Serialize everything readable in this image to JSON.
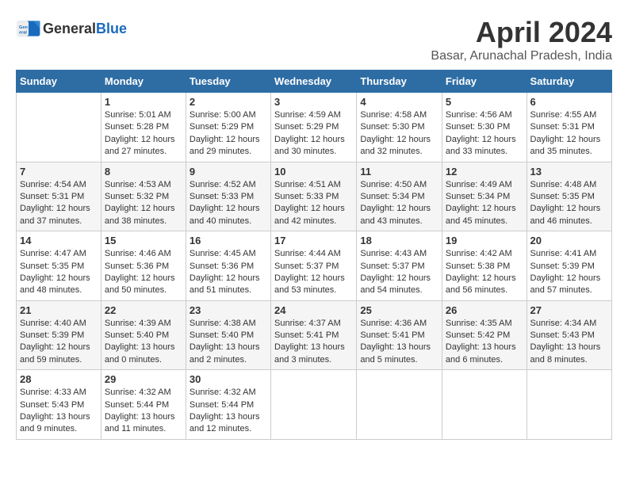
{
  "title": "April 2024",
  "subtitle": "Basar, Arunachal Pradesh, India",
  "logo": {
    "general": "General",
    "blue": "Blue"
  },
  "columns": [
    "Sunday",
    "Monday",
    "Tuesday",
    "Wednesday",
    "Thursday",
    "Friday",
    "Saturday"
  ],
  "weeks": [
    [
      {
        "day": "",
        "info": ""
      },
      {
        "day": "1",
        "info": "Sunrise: 5:01 AM\nSunset: 5:28 PM\nDaylight: 12 hours\nand 27 minutes."
      },
      {
        "day": "2",
        "info": "Sunrise: 5:00 AM\nSunset: 5:29 PM\nDaylight: 12 hours\nand 29 minutes."
      },
      {
        "day": "3",
        "info": "Sunrise: 4:59 AM\nSunset: 5:29 PM\nDaylight: 12 hours\nand 30 minutes."
      },
      {
        "day": "4",
        "info": "Sunrise: 4:58 AM\nSunset: 5:30 PM\nDaylight: 12 hours\nand 32 minutes."
      },
      {
        "day": "5",
        "info": "Sunrise: 4:56 AM\nSunset: 5:30 PM\nDaylight: 12 hours\nand 33 minutes."
      },
      {
        "day": "6",
        "info": "Sunrise: 4:55 AM\nSunset: 5:31 PM\nDaylight: 12 hours\nand 35 minutes."
      }
    ],
    [
      {
        "day": "7",
        "info": "Sunrise: 4:54 AM\nSunset: 5:31 PM\nDaylight: 12 hours\nand 37 minutes."
      },
      {
        "day": "8",
        "info": "Sunrise: 4:53 AM\nSunset: 5:32 PM\nDaylight: 12 hours\nand 38 minutes."
      },
      {
        "day": "9",
        "info": "Sunrise: 4:52 AM\nSunset: 5:33 PM\nDaylight: 12 hours\nand 40 minutes."
      },
      {
        "day": "10",
        "info": "Sunrise: 4:51 AM\nSunset: 5:33 PM\nDaylight: 12 hours\nand 42 minutes."
      },
      {
        "day": "11",
        "info": "Sunrise: 4:50 AM\nSunset: 5:34 PM\nDaylight: 12 hours\nand 43 minutes."
      },
      {
        "day": "12",
        "info": "Sunrise: 4:49 AM\nSunset: 5:34 PM\nDaylight: 12 hours\nand 45 minutes."
      },
      {
        "day": "13",
        "info": "Sunrise: 4:48 AM\nSunset: 5:35 PM\nDaylight: 12 hours\nand 46 minutes."
      }
    ],
    [
      {
        "day": "14",
        "info": "Sunrise: 4:47 AM\nSunset: 5:35 PM\nDaylight: 12 hours\nand 48 minutes."
      },
      {
        "day": "15",
        "info": "Sunrise: 4:46 AM\nSunset: 5:36 PM\nDaylight: 12 hours\nand 50 minutes."
      },
      {
        "day": "16",
        "info": "Sunrise: 4:45 AM\nSunset: 5:36 PM\nDaylight: 12 hours\nand 51 minutes."
      },
      {
        "day": "17",
        "info": "Sunrise: 4:44 AM\nSunset: 5:37 PM\nDaylight: 12 hours\nand 53 minutes."
      },
      {
        "day": "18",
        "info": "Sunrise: 4:43 AM\nSunset: 5:37 PM\nDaylight: 12 hours\nand 54 minutes."
      },
      {
        "day": "19",
        "info": "Sunrise: 4:42 AM\nSunset: 5:38 PM\nDaylight: 12 hours\nand 56 minutes."
      },
      {
        "day": "20",
        "info": "Sunrise: 4:41 AM\nSunset: 5:39 PM\nDaylight: 12 hours\nand 57 minutes."
      }
    ],
    [
      {
        "day": "21",
        "info": "Sunrise: 4:40 AM\nSunset: 5:39 PM\nDaylight: 12 hours\nand 59 minutes."
      },
      {
        "day": "22",
        "info": "Sunrise: 4:39 AM\nSunset: 5:40 PM\nDaylight: 13 hours\nand 0 minutes."
      },
      {
        "day": "23",
        "info": "Sunrise: 4:38 AM\nSunset: 5:40 PM\nDaylight: 13 hours\nand 2 minutes."
      },
      {
        "day": "24",
        "info": "Sunrise: 4:37 AM\nSunset: 5:41 PM\nDaylight: 13 hours\nand 3 minutes."
      },
      {
        "day": "25",
        "info": "Sunrise: 4:36 AM\nSunset: 5:41 PM\nDaylight: 13 hours\nand 5 minutes."
      },
      {
        "day": "26",
        "info": "Sunrise: 4:35 AM\nSunset: 5:42 PM\nDaylight: 13 hours\nand 6 minutes."
      },
      {
        "day": "27",
        "info": "Sunrise: 4:34 AM\nSunset: 5:43 PM\nDaylight: 13 hours\nand 8 minutes."
      }
    ],
    [
      {
        "day": "28",
        "info": "Sunrise: 4:33 AM\nSunset: 5:43 PM\nDaylight: 13 hours\nand 9 minutes."
      },
      {
        "day": "29",
        "info": "Sunrise: 4:32 AM\nSunset: 5:44 PM\nDaylight: 13 hours\nand 11 minutes."
      },
      {
        "day": "30",
        "info": "Sunrise: 4:32 AM\nSunset: 5:44 PM\nDaylight: 13 hours\nand 12 minutes."
      },
      {
        "day": "",
        "info": ""
      },
      {
        "day": "",
        "info": ""
      },
      {
        "day": "",
        "info": ""
      },
      {
        "day": "",
        "info": ""
      }
    ]
  ]
}
